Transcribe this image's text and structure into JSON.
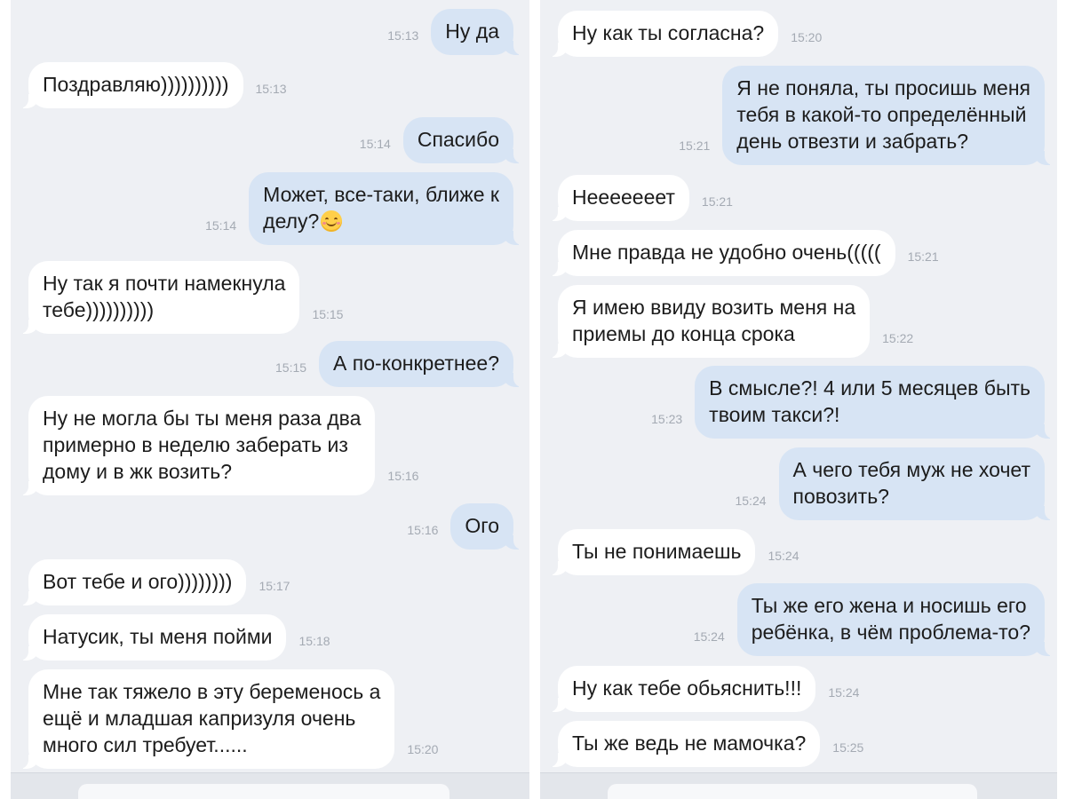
{
  "left_panel": {
    "messages": [
      {
        "dir": "out",
        "lines": [
          "Ну да"
        ],
        "time": "15:13"
      },
      {
        "dir": "in",
        "lines": [
          "Поздравляю))))))))))"
        ],
        "time": "15:13"
      },
      {
        "dir": "out",
        "lines": [
          "Спасибо"
        ],
        "time": "15:14"
      },
      {
        "dir": "out",
        "lines": [
          "Может, все-таки, ближе к",
          "делу?"
        ],
        "time": "15:14",
        "emoji": "smiling-face-emoji"
      },
      {
        "dir": "in",
        "lines": [
          "Ну так я почти намекнула",
          "тебе))))))))))"
        ],
        "time": "15:15"
      },
      {
        "dir": "out",
        "lines": [
          "А по-конкретнее?"
        ],
        "time": "15:15"
      },
      {
        "dir": "in",
        "lines": [
          "Ну не могла бы ты меня раза два",
          "примерно в неделю заберать из",
          "дому и в жк возить?"
        ],
        "time": "15:16"
      },
      {
        "dir": "out",
        "lines": [
          "Ого"
        ],
        "time": "15:16"
      },
      {
        "dir": "in",
        "lines": [
          "Вот тебе и ого))))))))"
        ],
        "time": "15:17"
      },
      {
        "dir": "in",
        "lines": [
          "Натусик, ты меня пойми"
        ],
        "time": "15:18"
      },
      {
        "dir": "in",
        "lines": [
          "Мне так тяжело в эту беременось а",
          "ещё и младшая капризуля очень",
          "много сил требует......"
        ],
        "time": "15:20"
      }
    ]
  },
  "right_panel": {
    "messages": [
      {
        "dir": "in",
        "lines": [
          "Ну как ты согласна?"
        ],
        "time": "15:20"
      },
      {
        "dir": "out",
        "lines": [
          "Я не поняла, ты просишь меня",
          "тебя в какой-то определённый",
          "день отвезти и забрать?"
        ],
        "time": "15:21"
      },
      {
        "dir": "in",
        "lines": [
          "Нееееееет"
        ],
        "time": "15:21"
      },
      {
        "dir": "in",
        "lines": [
          "Мне правда не удобно очень((((("
        ],
        "time": "15:21"
      },
      {
        "dir": "in",
        "lines": [
          "Я имею ввиду возить меня на",
          "приемы до конца срока"
        ],
        "time": "15:22"
      },
      {
        "dir": "out",
        "lines": [
          "В смысле?! 4 или 5 месяцев быть",
          "твоим такси?!"
        ],
        "time": "15:23"
      },
      {
        "dir": "out",
        "lines": [
          "А чего тебя муж не хочет",
          "повозить?"
        ],
        "time": "15:24"
      },
      {
        "dir": "in",
        "lines": [
          "Ты не понимаешь"
        ],
        "time": "15:24"
      },
      {
        "dir": "out",
        "lines": [
          "Ты же его жена и носишь его",
          "ребёнка, в чём проблема-то?"
        ],
        "time": "15:24"
      },
      {
        "dir": "in",
        "lines": [
          "Ну как тебе обьяснить!!!"
        ],
        "time": "15:24"
      },
      {
        "dir": "in",
        "lines": [
          "Ты же ведь не мамочка?"
        ],
        "time": "15:25"
      }
    ]
  },
  "colors": {
    "background": "#eef0f4",
    "incoming_bubble": "#ffffff",
    "outgoing_bubble": "#d7e4f4",
    "timestamp": "#a4aab3"
  }
}
